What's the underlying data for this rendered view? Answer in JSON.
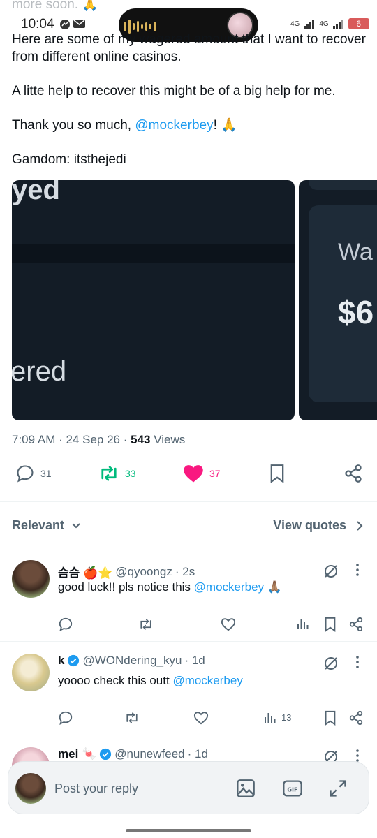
{
  "status": {
    "time": "10:04",
    "network1": "4G",
    "network2": "4G",
    "battery": "6",
    "faded_top": "more soon. 🙏"
  },
  "post": {
    "line1_prefix": "Here are some of ",
    "line1_hidden": "my wagered amount",
    "line1_suffix": " that I want to recover from different online casinos.",
    "para2": "A litte help to recover this might be of a big help for me.",
    "para3_prefix": "Thank you so much, ",
    "para3_mention": "@mockerbey",
    "para3_suffix": "! 🙏",
    "para4": "Gamdom: itsthejedi",
    "image1_top_text": "yed",
    "image1_bottom_text": "ered",
    "image2_label": "Wa",
    "image2_amount": "$6",
    "time": "7:09 AM",
    "date": "24 Sep 26",
    "views_count": "543",
    "views_label": " Views"
  },
  "actions": {
    "replies": "31",
    "reposts": "33",
    "likes": "37",
    "colors": {
      "repost": "#00ba7c",
      "like": "#f91880",
      "mention": "#1d9bf0"
    }
  },
  "sort": {
    "label": "Relevant",
    "view_quotes": "View quotes"
  },
  "replies": [
    {
      "name": "슴슴 🍎⭐",
      "handle": "@qyoongz",
      "time": "· 2s",
      "text_prefix": "good luck!! pls notice this ",
      "mention": "@mockerbey",
      "text_suffix": " 🙏🏽",
      "views": ""
    },
    {
      "name": "k",
      "handle": "@WONdering_kyu",
      "time": "· 1d",
      "text_prefix": "yoooo check this outt ",
      "mention": "@mockerbey",
      "text_suffix": "",
      "views": "13"
    },
    {
      "name": "mei 🍬",
      "handle": "@nunewfeed",
      "time": "· 1d"
    }
  ],
  "composer": {
    "placeholder": "Post your reply"
  }
}
